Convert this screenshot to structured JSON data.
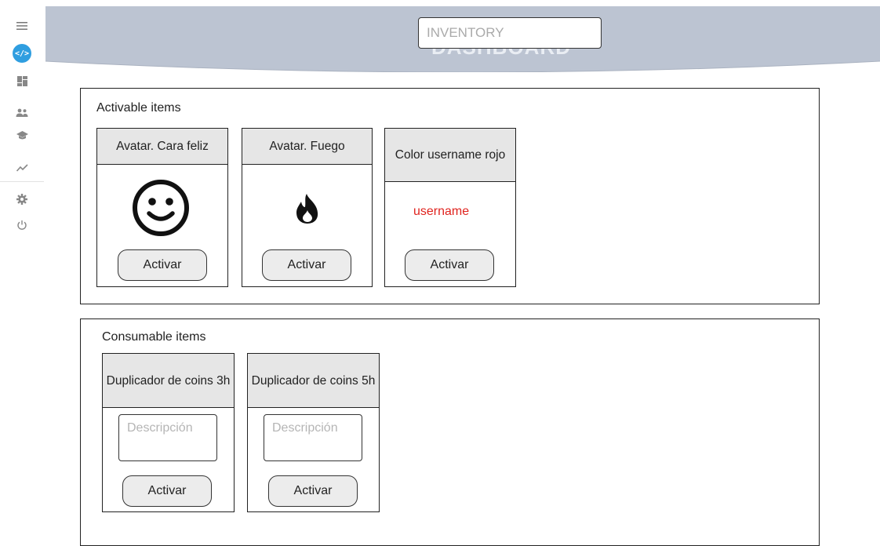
{
  "sidebar": {
    "items": [
      {
        "icon": "menu-icon"
      },
      {
        "icon": "code-logo-icon",
        "glyph": "</>"
      },
      {
        "icon": "dashboard-icon"
      },
      {
        "icon": "users-icon"
      },
      {
        "icon": "graduation-cap-icon"
      },
      {
        "icon": "trending-icon"
      },
      {
        "icon": "settings-icon"
      },
      {
        "icon": "power-icon"
      }
    ],
    "accent_color": "#2f9ee0"
  },
  "header": {
    "search_placeholder": "INVENTORY",
    "ghost_title": "DASHBOARD",
    "banner_color": "#bcc4d2"
  },
  "activable": {
    "title": "Activable items",
    "cards": [
      {
        "title": "Avatar. Cara feliz",
        "icon": "smiley-icon",
        "button": "Activar"
      },
      {
        "title": "Avatar. Fuego",
        "icon": "fire-icon",
        "button": "Activar"
      },
      {
        "title": "Color username rojo",
        "preview": "username",
        "preview_color": "#e0241f",
        "button": "Activar"
      }
    ]
  },
  "consumable": {
    "title": "Consumable items",
    "cards": [
      {
        "title": "Duplicador de coins 3h",
        "description_placeholder": "Descripción",
        "button": "Activar"
      },
      {
        "title": "Duplicador de coins 5h",
        "description_placeholder": "Descripción",
        "button": "Activar"
      }
    ]
  }
}
